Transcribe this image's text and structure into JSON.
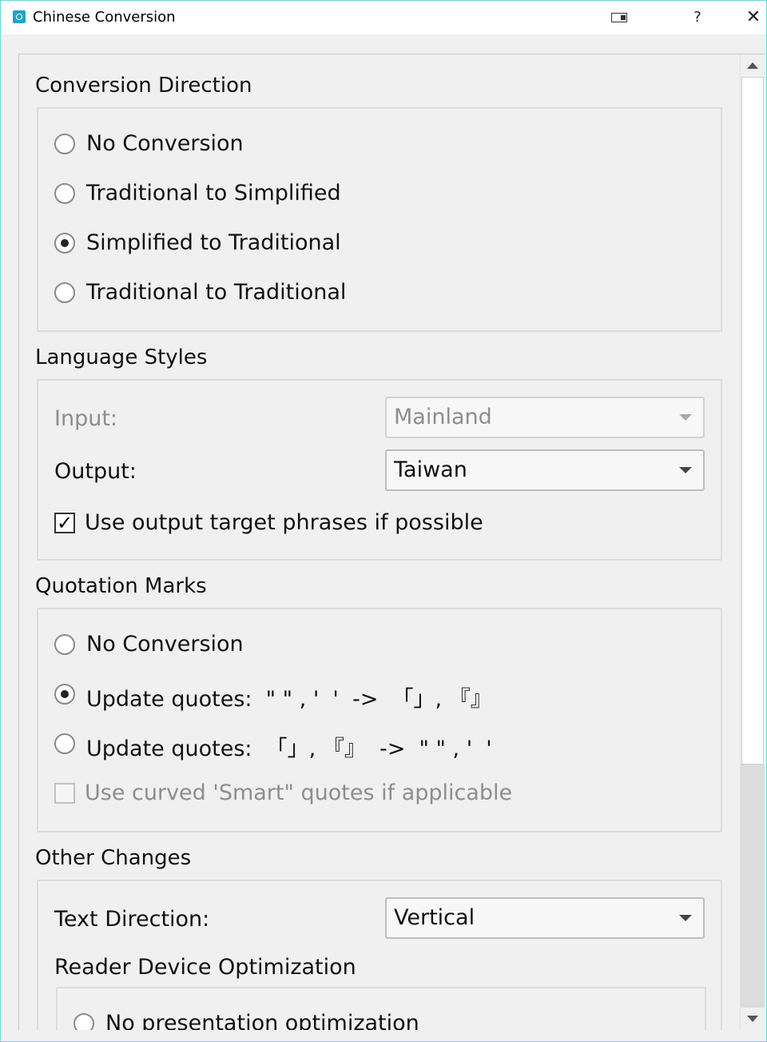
{
  "window": {
    "title": "Chinese Conversion",
    "help_label": "?",
    "close_label": "✕"
  },
  "conversion_direction": {
    "title": "Conversion Direction",
    "options": [
      {
        "label": "No Conversion",
        "checked": false
      },
      {
        "label": "Traditional to Simplified",
        "checked": false
      },
      {
        "label": "Simplified to Traditional",
        "checked": true
      },
      {
        "label": "Traditional to Traditional",
        "checked": false
      }
    ]
  },
  "language_styles": {
    "title": "Language Styles",
    "input_label": "Input:",
    "input_value": "Mainland",
    "output_label": "Output:",
    "output_value": "Taiwan",
    "phrases_label": "Use output target phrases if possible",
    "phrases_checked": true,
    "check_mark": "✓"
  },
  "quotation_marks": {
    "title": "Quotation Marks",
    "options": [
      {
        "label": "No Conversion",
        "checked": false
      },
      {
        "label": "Update quotes:  \" \" , '  '  ->  「」, 『』",
        "checked": true
      },
      {
        "label": "Update quotes:  「」, 『』  ->  \" \" , '  '",
        "checked": false
      }
    ],
    "smart_label": "Use curved 'Smart\" quotes if applicable",
    "smart_checked": false
  },
  "other_changes": {
    "title": "Other Changes",
    "text_direction_label": "Text Direction:",
    "text_direction_value": "Vertical",
    "reader_optimization_title": "Reader Device Optimization",
    "reader_options": [
      {
        "label": "No presentation optimization",
        "checked": false
      }
    ]
  }
}
